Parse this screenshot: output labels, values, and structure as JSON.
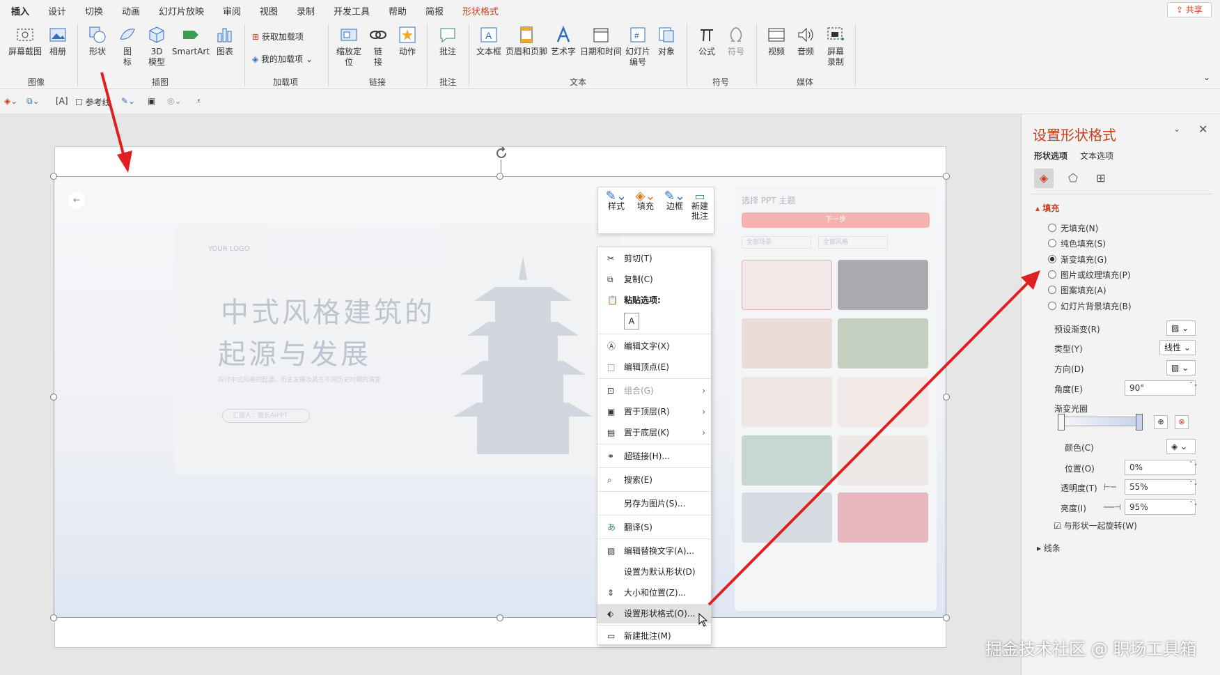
{
  "tabs": [
    "插入",
    "设计",
    "切换",
    "动画",
    "幻灯片放映",
    "审阅",
    "视图",
    "录制",
    "开发工具",
    "帮助",
    "简报",
    "形状格式"
  ],
  "share": "共享",
  "ribbon": {
    "buttons": [
      {
        "label": "屏幕截图",
        "sub": "⌄"
      },
      {
        "label": "相册",
        "sub": "⌄"
      },
      {
        "label": "形状",
        "sub": "⌄"
      },
      {
        "label": "图\n标"
      },
      {
        "label": "3D\n模型"
      },
      {
        "label": "SmartArt"
      },
      {
        "label": "图表"
      },
      {
        "label": "缩放定\n位"
      },
      {
        "label": "链\n接"
      },
      {
        "label": "动作"
      },
      {
        "label": "批注"
      },
      {
        "label": "文本框"
      },
      {
        "label": "页眉和页脚"
      },
      {
        "label": "艺术字"
      },
      {
        "label": "日期和时间"
      },
      {
        "label": "幻灯片\n编号"
      },
      {
        "label": "对象"
      },
      {
        "label": "公式"
      },
      {
        "label": "符号"
      },
      {
        "label": "视频"
      },
      {
        "label": "音频"
      },
      {
        "label": "屏幕\n录制"
      }
    ],
    "addins": [
      "获取加载项",
      "我的加载项"
    ],
    "groups": [
      "图像",
      "插图",
      "加载项",
      "链接",
      "批注",
      "文本",
      "符号",
      "媒体"
    ]
  },
  "qat": {
    "ref_label": "参考线"
  },
  "slide": {
    "logo": "YOUR LOGO",
    "title_line1": "中式风格建筑的",
    "title_line2": "起源与发展",
    "subtitle": "探讨中式风格的起源、历史发展及其在不同历史时期的演变",
    "button": "汇报人：擅长AIPPT",
    "right_title": "选择 PPT 主题",
    "next": "下一步",
    "filter1": "全部场景",
    "filter2": "全部风格"
  },
  "minibar": {
    "style": "样式",
    "fill": "填充",
    "border": "边框",
    "comment": "新建\n批注"
  },
  "menu": {
    "cut": "剪切(T)",
    "copy": "复制(C)",
    "paste_opts": "粘贴选项:",
    "edit_text": "编辑文字(X)",
    "edit_points": "编辑顶点(E)",
    "group": "组合(G)",
    "bring_front": "置于顶层(R)",
    "send_back": "置于底层(K)",
    "hyperlink": "超链接(H)...",
    "search": "搜索(E)",
    "save_pic": "另存为图片(S)...",
    "translate": "翻译(S)",
    "alt_text": "编辑替换文字(A)...",
    "default_shape": "设置为默认形状(D)",
    "size_pos": "大小和位置(Z)...",
    "format_shape": "设置形状格式(O)...",
    "new_comment": "新建批注(M)"
  },
  "panel": {
    "title": "设置形状格式",
    "tab_shape": "形状选项",
    "tab_text": "文本选项",
    "fill_header": "填充",
    "opts": [
      "无填充(N)",
      "纯色填充(S)",
      "渐变填充(G)",
      "图片或纹理填充(P)",
      "图案填充(A)",
      "幻灯片背景填充(B)"
    ],
    "selected": 2,
    "preset": "预设渐变(R)",
    "type": "类型(Y)",
    "type_val": "线性",
    "direction": "方向(D)",
    "angle": "角度(E)",
    "angle_val": "90°",
    "stops": "渐变光圈",
    "color": "颜色(C)",
    "position": "位置(O)",
    "position_val": "0%",
    "transparency": "透明度(T)",
    "transparency_val": "55%",
    "brightness": "亮度(I)",
    "brightness_val": "95%",
    "rotate": "与形状一起旋转(W)",
    "line_header": "线条"
  },
  "watermark": "掘金技术社区 @ 职场工具箱"
}
